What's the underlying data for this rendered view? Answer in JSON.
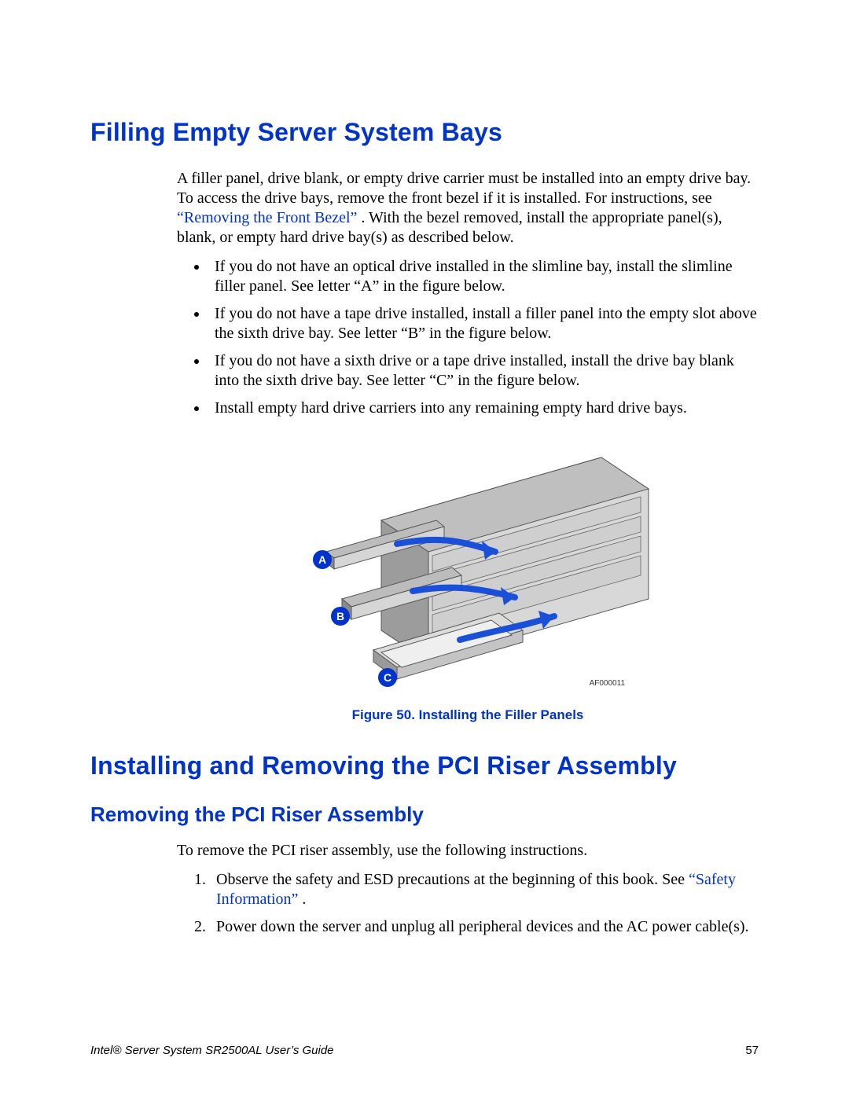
{
  "headings": {
    "h1a": "Filling Empty Server System Bays",
    "h1b": "Installing and Removing the PCI Riser Assembly",
    "h2a": "Removing the PCI Riser Assembly"
  },
  "para1_pre": "A filler panel, drive blank, or empty drive carrier must be installed into an empty drive bay. To access the drive bays, remove the front bezel if it is installed. For instructions, see ",
  "para1_link": "“Removing the Front Bezel”",
  "para1_post": ". With the bezel removed, install the appropriate panel(s), blank, or empty hard drive bay(s) as described below.",
  "bullets": [
    "If you do not have an optical drive installed in the slimline bay, install the slimline filler panel. See letter “A” in the figure below.",
    "If you do not have a tape drive installed, install a filler panel into the empty slot above the sixth drive bay. See letter “B” in the figure below.",
    "If you do not have a sixth drive or a tape drive installed, install the drive bay blank into the sixth drive bay. See letter “C” in the figure below.",
    "Install empty hard drive carriers into any remaining empty hard drive bays."
  ],
  "figure": {
    "labels": {
      "A": "A",
      "B": "B",
      "C": "C"
    },
    "af": "AF000011",
    "caption": "Figure 50. Installing the Filler Panels"
  },
  "para2": "To remove the PCI riser assembly, use the following instructions.",
  "steps": {
    "s1_pre": "Observe the safety and ESD precautions at the beginning of this book. See ",
    "s1_link": "“Safety Information”",
    "s1_post": ".",
    "s2": "Power down the server and unplug all peripheral devices and the AC power cable(s)."
  },
  "footer": {
    "title": "Intel® Server System SR2500AL User’s Guide",
    "page": "57"
  }
}
